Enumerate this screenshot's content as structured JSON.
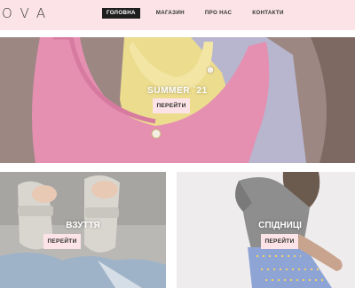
{
  "header": {
    "logo": "OVA",
    "nav": [
      {
        "label": "ГОЛОВНА",
        "active": true
      },
      {
        "label": "МАГАЗИН",
        "active": false
      },
      {
        "label": "ПРО НАС",
        "active": false
      },
      {
        "label": "КОНТАКТИ",
        "active": false
      }
    ]
  },
  "hero": {
    "title": "SUMMER `21",
    "button_label": "ПЕРЕЙТИ"
  },
  "cards": [
    {
      "title": "ВЗУТТЯ",
      "button_label": "ПЕРЕЙТИ"
    },
    {
      "title": "СПІДНИЦІ",
      "button_label": "ПЕРЕЙТИ"
    }
  ],
  "colors": {
    "header_bg": "#fbe3e7",
    "active_nav_bg": "#1e1e1e",
    "button_bg": "#fbe3e7"
  }
}
